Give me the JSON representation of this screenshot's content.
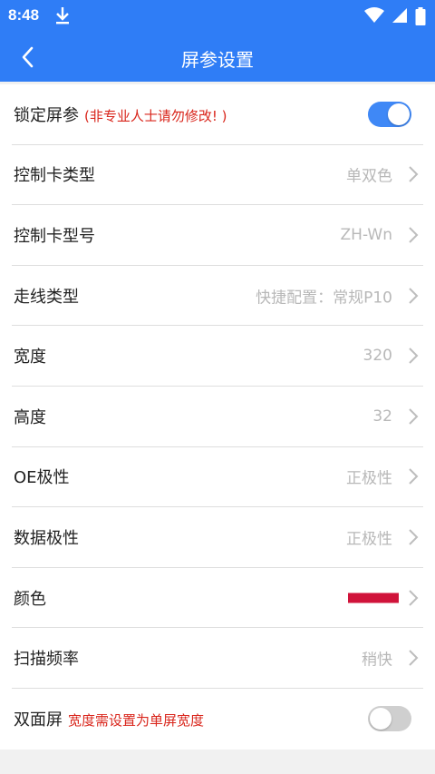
{
  "status_bar": {
    "time": "8:48",
    "icons": [
      "download-icon",
      "wifi-icon",
      "signal-icon",
      "battery-icon"
    ]
  },
  "app_bar": {
    "title": "屏参设置",
    "back_icon": "chevron-left-icon"
  },
  "settings": {
    "lock_params": {
      "label": "锁定屏参",
      "warning": "(非专业人士请勿修改! )",
      "enabled": true
    },
    "card_type": {
      "label": "控制卡类型",
      "value": "单双色"
    },
    "card_model": {
      "label": "控制卡型号",
      "value": "ZH-Wn"
    },
    "wiring_type": {
      "label": "走线类型",
      "value": "快捷配置：常规P10"
    },
    "width": {
      "label": "宽度",
      "value": "320"
    },
    "height": {
      "label": "高度",
      "value": "32"
    },
    "oe_polarity": {
      "label": "OE极性",
      "value": "正极性"
    },
    "data_polarity": {
      "label": "数据极性",
      "value": "正极性"
    },
    "color": {
      "label": "颜色",
      "swatch": "#d0133a"
    },
    "scan_rate": {
      "label": "扫描频率",
      "value": "稍快"
    },
    "double_sided": {
      "label": "双面屏",
      "warning": "宽度需设置为单屏宽度",
      "enabled": false
    }
  },
  "colors": {
    "primary": "#2f7df6",
    "toggle_on": "#3f88f6",
    "warning": "#d9261c"
  }
}
